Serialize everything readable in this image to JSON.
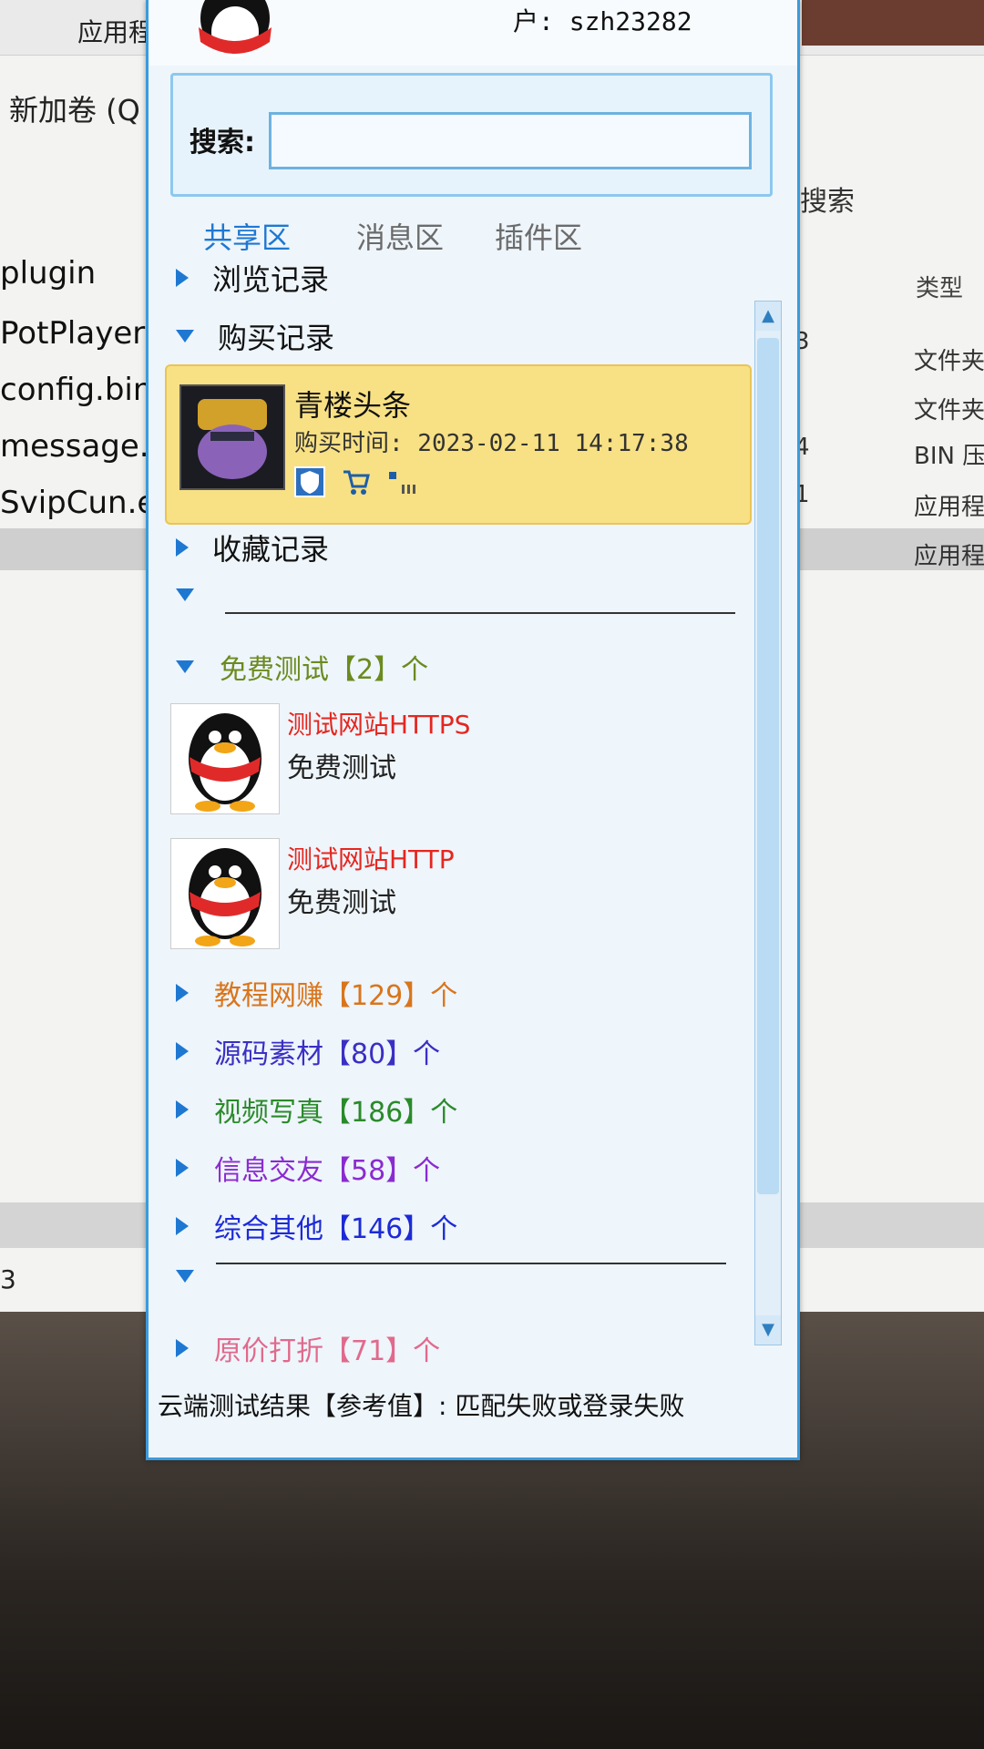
{
  "explorer": {
    "menu_label": "应用程",
    "location": "新加卷 (Q",
    "search_label": "搜索",
    "column_type": "类型",
    "files": [
      {
        "name": "plugin",
        "num": "",
        "type": ""
      },
      {
        "name": "PotPlayer",
        "num": "3",
        "type": "文件夹"
      },
      {
        "name": "config.bin",
        "num": "",
        "type": "文件夹"
      },
      {
        "name": "message.c",
        "num": "4",
        "type": "BIN 压"
      },
      {
        "name": "SvipCun.e",
        "num": "1",
        "type": "应用程"
      },
      {
        "name": "",
        "num": "",
        "type": "应用程"
      }
    ],
    "bottom_number": "3"
  },
  "panel": {
    "username": "户: szh23282",
    "search": {
      "label": "搜索:",
      "value": "",
      "placeholder": ""
    },
    "tabs": [
      {
        "label": "共享区",
        "active": true
      },
      {
        "label": "消息区",
        "active": false
      },
      {
        "label": "插件区",
        "active": false
      }
    ],
    "sections": {
      "browse": "浏览记录",
      "purchase": "购买记录",
      "favorites": "收藏记录"
    },
    "purchase_item": {
      "name": "青楼头条",
      "time_label": "购买时间: 2023-02-11 14:17:38"
    },
    "free_test": {
      "label": "免费测试",
      "count": "【2】个"
    },
    "test_items": [
      {
        "title": "测试网站HTTPS",
        "subtitle": "免费测试"
      },
      {
        "title": "测试网站HTTP",
        "subtitle": "免费测试"
      }
    ],
    "categories": [
      {
        "label": "教程网赚",
        "count": "【129】个",
        "color": "#d9751c"
      },
      {
        "label": "源码素材",
        "count": "【80】个",
        "color": "#3a2fc4"
      },
      {
        "label": "视频写真",
        "count": "【186】个",
        "color": "#2a8a2a"
      },
      {
        "label": "信息交友",
        "count": "【58】个",
        "color": "#8a2bd0"
      },
      {
        "label": "综合其他",
        "count": "【146】个",
        "color": "#1d2ad6"
      }
    ],
    "discount": {
      "label": "原价打折",
      "count": "【71】个",
      "color": "#e06a8c"
    },
    "status": "云端测试结果【参考值】: 匹配失败或登录失败"
  }
}
